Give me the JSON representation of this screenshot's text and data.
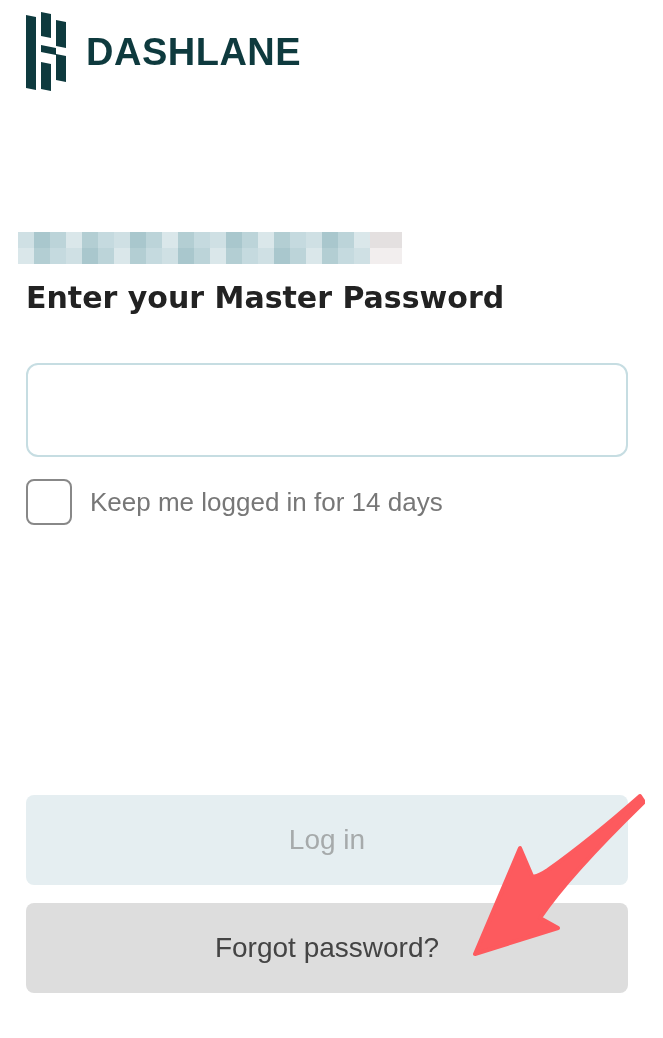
{
  "logo": {
    "wordmark": "DASHLANE"
  },
  "heading": "Enter your Master Password",
  "remember": {
    "label": "Keep me logged in for 14 days",
    "checked": false
  },
  "buttons": [
    {
      "label": "Log in",
      "disabled": true
    },
    {
      "label": "Forgot password?",
      "disabled": false
    }
  ]
}
